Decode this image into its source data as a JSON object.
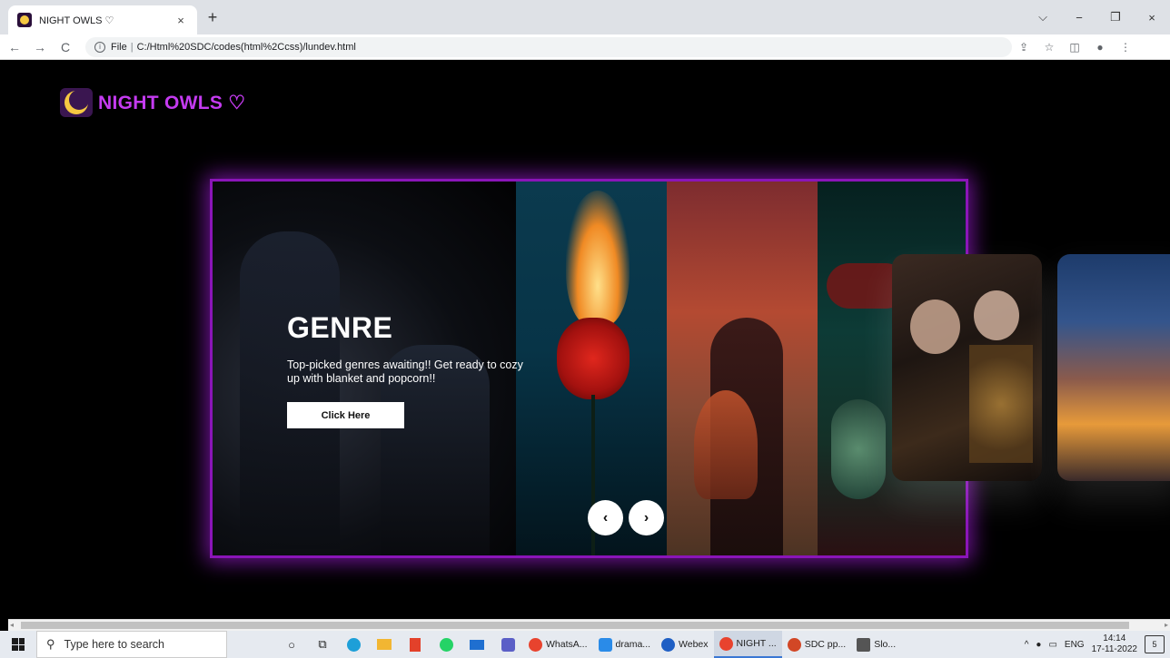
{
  "browser": {
    "tab_title": "NIGHT OWLS ♡",
    "tab_close": "×",
    "new_tab": "+",
    "nav": {
      "back": "←",
      "forward": "→",
      "reload": "C"
    },
    "address": {
      "scheme": "File",
      "url": "C:/Html%20SDC/codes(html%2Ccss)/lundev.html"
    },
    "window_controls": {
      "tabsearch": "⌵",
      "minimize": "−",
      "maximize": "❐",
      "close": "×"
    },
    "toolbar_icons": {
      "share": "⇪",
      "star": "☆",
      "sidebar": "◫",
      "profile": "●",
      "menu": "⋮"
    }
  },
  "page": {
    "logo_text": "NIGHT OWLS ♡",
    "hero": {
      "title": "GENRE",
      "text": "Top-picked genres awaiting!! Get ready to cozy up with blanket and popcorn!!",
      "cta": "Click Here"
    },
    "arrows": {
      "prev": "‹",
      "next": "›"
    },
    "scroll_left": "◂",
    "scroll_right": "▸"
  },
  "taskbar": {
    "search_placeholder": "Type here to search",
    "apps": [
      {
        "label": "WhatsA...",
        "color": "#e8432e"
      },
      {
        "label": "drama...",
        "color": "#2a8be8"
      },
      {
        "label": "Webex",
        "color": "#1f5fc4"
      },
      {
        "label": "NIGHT ...",
        "color": "#e8432e"
      },
      {
        "label": "SDC pp...",
        "color": "#d24726"
      },
      {
        "label": "Slo...",
        "color": "#555555"
      }
    ],
    "tray": {
      "lang": "ENG",
      "time": "14:14",
      "date": "17-11-2022",
      "notifications": "5"
    }
  }
}
